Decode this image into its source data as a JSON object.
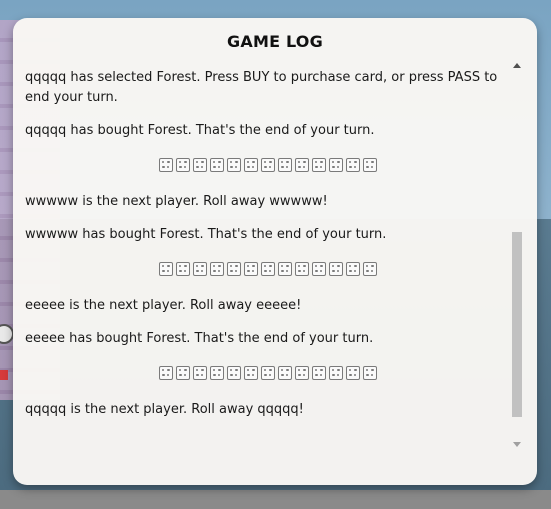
{
  "log": {
    "title": "GAME LOG",
    "entries": [
      {
        "type": "text",
        "text": "qqqqq has selected Forest. Press BUY to purchase card, or press PASS to end your turn."
      },
      {
        "type": "text",
        "text": "qqqqq has bought Forest. That's the end of your turn."
      },
      {
        "type": "dice"
      },
      {
        "type": "text",
        "text": "wwwww is the next player. Roll away wwwww!"
      },
      {
        "type": "text",
        "text": "wwwww has bought Forest. That's the end of your turn."
      },
      {
        "type": "dice"
      },
      {
        "type": "text",
        "text": "eeeee is the next player. Roll away eeeee!"
      },
      {
        "type": "text",
        "text": "eeeee has bought Forest. That's the end of your turn."
      },
      {
        "type": "dice"
      },
      {
        "type": "text",
        "text": "qqqqq is the next player. Roll away qqqqq!"
      }
    ],
    "dice_icons_per_row": 13,
    "scroll_position_fraction": 0.45
  },
  "colors": {
    "panel_background": "#f9f7f4",
    "text": "#1a1a1a",
    "dice_icon": "#7a7a7a",
    "scrollbar_thumb": "#c1c1c1"
  },
  "icons": {
    "dice": "dice-icon",
    "scroll_up": "scroll-up-arrow-icon",
    "scroll_down": "scroll-down-arrow-icon"
  }
}
